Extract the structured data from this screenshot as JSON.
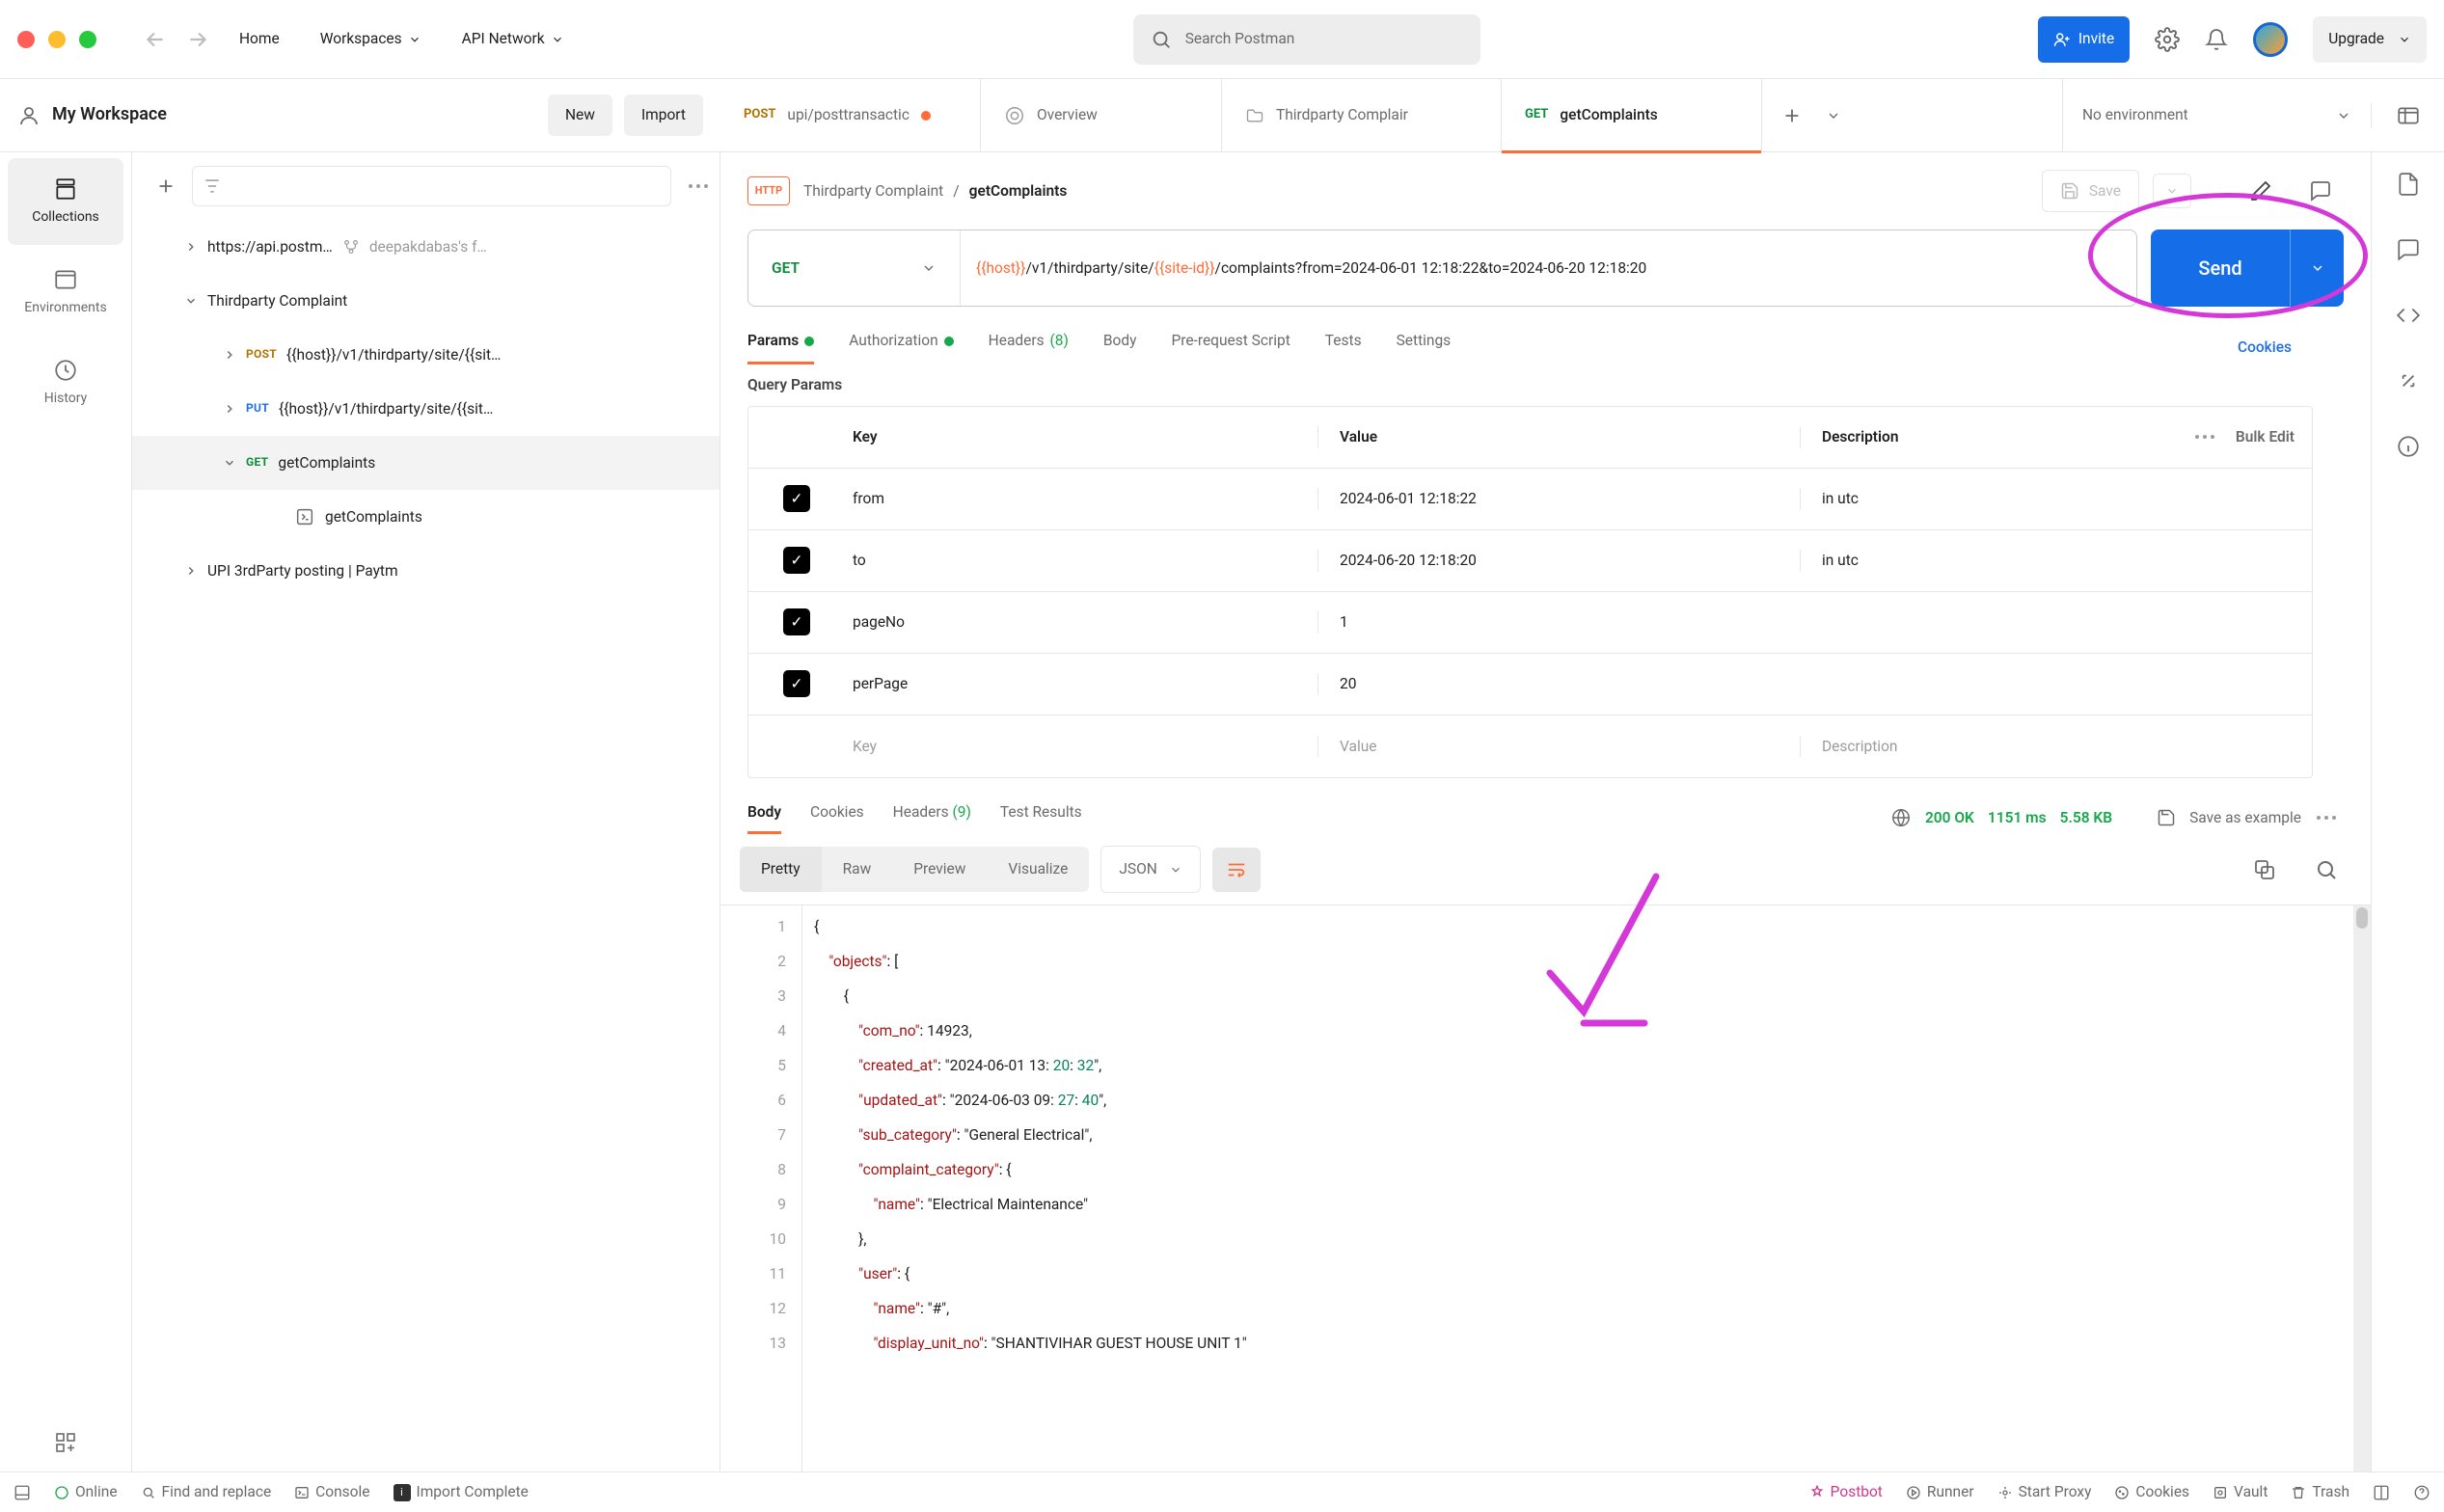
{
  "app": {
    "search_placeholder": "Search Postman",
    "invite": "Invite",
    "upgrade": "Upgrade"
  },
  "top_nav": {
    "home": "Home",
    "workspaces": "Workspaces",
    "api_network": "API Network"
  },
  "workspace": {
    "name": "My Workspace",
    "new": "New",
    "import": "Import"
  },
  "tabs": [
    {
      "method": "POST",
      "label": "upi/posttransactic",
      "dirty": true
    },
    {
      "label": "Overview"
    },
    {
      "label": "Thirdparty Complair"
    },
    {
      "method": "GET",
      "label": "getComplaints",
      "active": true
    }
  ],
  "environment": "No environment",
  "sidebar": {
    "nav": {
      "collections": "Collections",
      "environments": "Environments",
      "history": "History"
    },
    "tree": [
      {
        "label": "https://api.postm…",
        "fork": "deepakdabas's f…"
      },
      {
        "label": "Thirdparty Complaint",
        "expanded": true,
        "children": [
          {
            "method": "POST",
            "label": "{{host}}/v1/thirdparty/site/{{sit…"
          },
          {
            "method": "PUT",
            "label": "{{host}}/v1/thirdparty/site/{{sit…"
          },
          {
            "method": "GET",
            "label": "getComplaints",
            "expanded": true,
            "selected": true,
            "children": [
              {
                "icon": "example",
                "label": "getComplaints"
              }
            ]
          }
        ]
      },
      {
        "label": "UPI 3rdParty posting | Paytm"
      }
    ]
  },
  "request": {
    "breadcrumb_parent": "Thirdparty Complaint",
    "breadcrumb_current": "getComplaints",
    "save": "Save",
    "method": "GET",
    "url_pre_host": "{{host}}",
    "url_mid": "/v1/thirdparty/site/",
    "url_post_site": "{{site-id}}",
    "url_tail": "/complaints?from=2024-06-01 12:18:22&to=2024-06-20 12:18:20",
    "send": "Send"
  },
  "param_tabs": {
    "params": "Params",
    "auth": "Authorization",
    "headers": "Headers",
    "headers_count": "(8)",
    "body": "Body",
    "pre": "Pre-request Script",
    "tests": "Tests",
    "settings": "Settings",
    "cookies": "Cookies"
  },
  "query_params": {
    "title": "Query Params",
    "cols": {
      "key": "Key",
      "value": "Value",
      "desc": "Description",
      "bulk": "Bulk Edit"
    },
    "rows": [
      {
        "key": "from",
        "value": "2024-06-01 12:18:22",
        "desc": "in utc"
      },
      {
        "key": "to",
        "value": "2024-06-20 12:18:20",
        "desc": "in utc"
      },
      {
        "key": "pageNo",
        "value": "1",
        "desc": ""
      },
      {
        "key": "perPage",
        "value": "20",
        "desc": ""
      }
    ],
    "placeholder": {
      "key": "Key",
      "value": "Value",
      "desc": "Description"
    }
  },
  "response": {
    "tabs": {
      "body": "Body",
      "cookies": "Cookies",
      "headers": "Headers",
      "headers_count": "(9)",
      "test": "Test Results"
    },
    "status_code": "200 OK",
    "time": "1151 ms",
    "size": "5.58 KB",
    "save_example": "Save as example",
    "views": {
      "pretty": "Pretty",
      "raw": "Raw",
      "preview": "Preview",
      "visualize": "Visualize"
    },
    "format": "JSON",
    "body_lines": [
      "{",
      "    \"objects\": [",
      "        {",
      "            \"com_no\": 14923,",
      "            \"created_at\": \"2024-06-01 13:20:32\",",
      "            \"updated_at\": \"2024-06-03 09:27:40\",",
      "            \"sub_category\": \"General Electrical\",",
      "            \"complaint_category\": {",
      "                \"name\": \"Electrical Maintenance\"",
      "            },",
      "            \"user\": {",
      "                \"name\": \"#\",",
      "                \"display_unit_no\": \"SHANTIVIHAR GUEST HOUSE UNIT 1\""
    ]
  },
  "statusbar": {
    "online": "Online",
    "find": "Find and replace",
    "console": "Console",
    "import_status": "Import Complete",
    "postbot": "Postbot",
    "runner": "Runner",
    "proxy": "Start Proxy",
    "cookies": "Cookies",
    "vault": "Vault",
    "trash": "Trash"
  }
}
